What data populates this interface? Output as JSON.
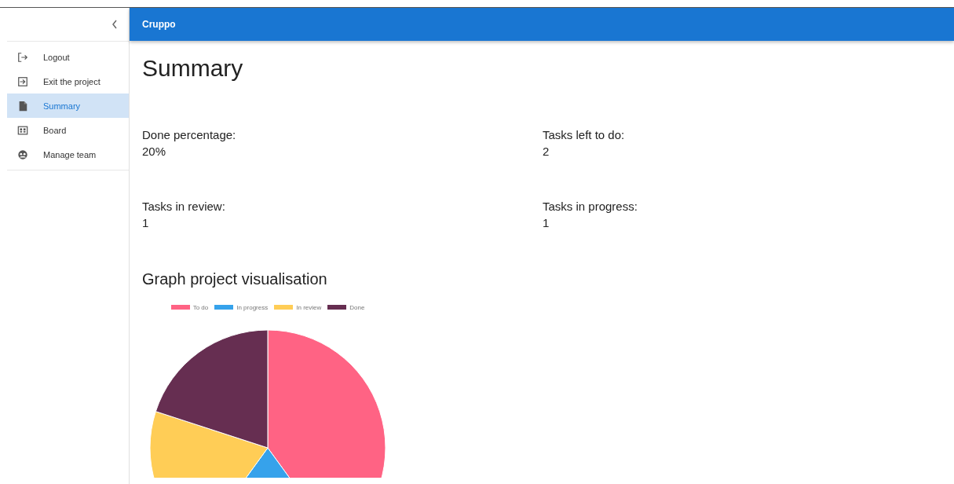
{
  "header": {
    "title": "Cruppo"
  },
  "sidebar": {
    "items": [
      {
        "label": "Logout",
        "selected": false
      },
      {
        "label": "Exit the project",
        "selected": false
      },
      {
        "label": "Summary",
        "selected": true
      },
      {
        "label": "Board",
        "selected": false
      },
      {
        "label": "Manage team",
        "selected": false
      }
    ]
  },
  "page": {
    "title": "Summary",
    "stats": [
      {
        "label": "Done percentage:",
        "value": "20%"
      },
      {
        "label": "Tasks left to do:",
        "value": "2"
      },
      {
        "label": "Tasks in review:",
        "value": "1"
      },
      {
        "label": "Tasks in progress:",
        "value": "1"
      }
    ],
    "graph_title": "Graph project visualisation",
    "chart_data": {
      "type": "pie",
      "legend": "top",
      "categories": [
        "To do",
        "In progress",
        "In review",
        "Done"
      ],
      "values": [
        40,
        20,
        20,
        20
      ],
      "colors": [
        "#ff6384",
        "#36a2eb",
        "#ffcd56",
        "#662e51"
      ]
    }
  }
}
